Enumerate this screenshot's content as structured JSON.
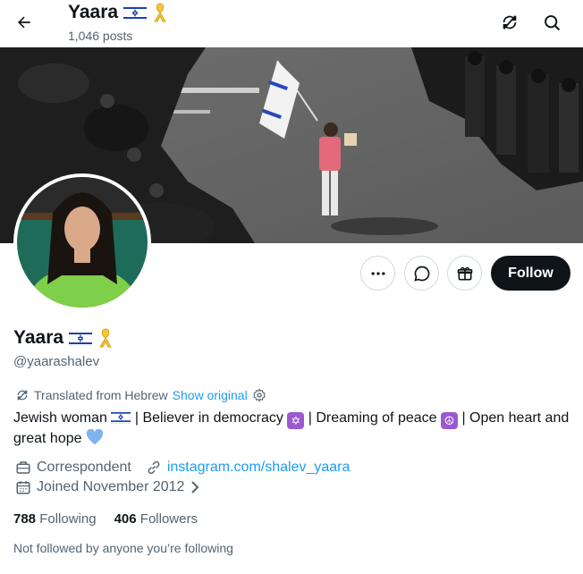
{
  "header": {
    "name": "Yaara",
    "posts": "1,046 posts"
  },
  "actions": {
    "follow_label": "Follow"
  },
  "profile": {
    "name": "Yaara",
    "handle": "@yaarashalev",
    "translated_label": "Translated from Hebrew",
    "show_original": "Show original",
    "bio": {
      "part1": "Jewish woman",
      "part2": "| Believer in democracy",
      "part3": "| Dreaming of peace",
      "part4": "| Open heart and great hope"
    },
    "occupation": "Correspondent",
    "link": "instagram.com/shalev_yaara",
    "joined": "Joined November 2012",
    "following_count": "788",
    "following_label": "Following",
    "followers_count": "406",
    "followers_label": "Followers",
    "not_followed": "Not followed by anyone you’re following"
  },
  "colors": {
    "accent": "#1d9bf0",
    "text": "#0f1419",
    "muted": "#536471",
    "ribbon": "#f5c542"
  }
}
